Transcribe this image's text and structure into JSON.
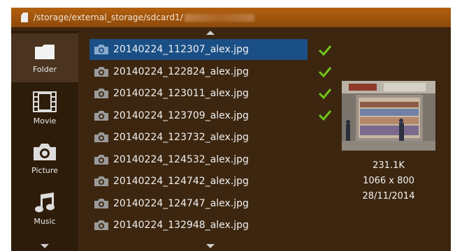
{
  "path": {
    "text": "/storage/external_storage/sdcard1/"
  },
  "sidebar": {
    "items": [
      {
        "label": "Folder",
        "icon": "folder-icon"
      },
      {
        "label": "Movie",
        "icon": "film-icon"
      },
      {
        "label": "Picture",
        "icon": "camera-icon"
      },
      {
        "label": "Music",
        "icon": "music-note-icon"
      }
    ],
    "selected": "Folder"
  },
  "files": [
    {
      "name": "20140224_112307_alex.jpg",
      "checked": true,
      "selected": true
    },
    {
      "name": "20140224_122824_alex.jpg",
      "checked": true
    },
    {
      "name": "20140224_123011_alex.jpg",
      "checked": true
    },
    {
      "name": "20140224_123709_alex.jpg",
      "checked": true
    },
    {
      "name": "20140224_123732_alex.jpg",
      "checked": false
    },
    {
      "name": "20140224_124532_alex.jpg",
      "checked": false
    },
    {
      "name": "20140224_124742_alex.jpg",
      "checked": false
    },
    {
      "name": "20140224_124747_alex.jpg",
      "checked": false
    },
    {
      "name": "20140224_132948_alex.jpg",
      "checked": false
    }
  ],
  "preview": {
    "size": "231.1K",
    "dimensions": "1066 x 800",
    "date": "28/11/2014"
  },
  "colors": {
    "background": "#3d260f",
    "header": "#9b520b",
    "selection": "#1a4f86",
    "check": "#6fc61b"
  }
}
